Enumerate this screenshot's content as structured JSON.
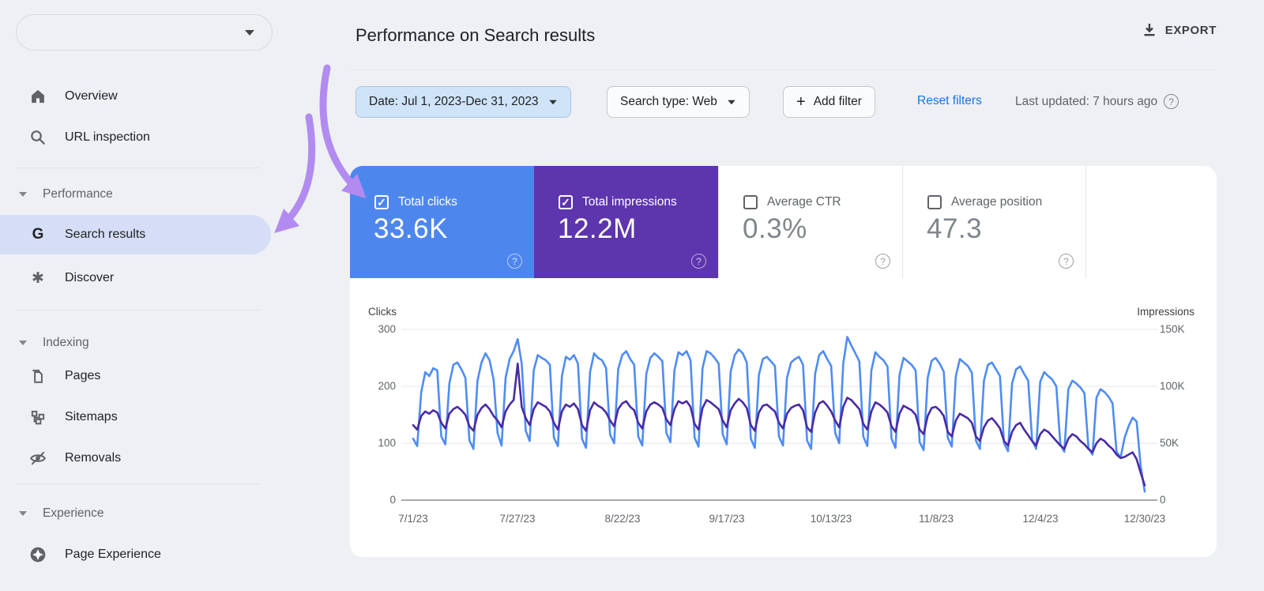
{
  "ui": {
    "check": "✓",
    "help": "?",
    "plus": "+"
  },
  "colors": {
    "accent_blue": "#4d87ee",
    "accent_purple": "#5d35ad",
    "line_blue": "#4e8cf5",
    "line_purple": "#4a2ba3",
    "arrow": "#b28bf0",
    "selected_pill": "#d5def6",
    "link_blue": "#1a73e8",
    "date_chip_bg": "#cfe4f9"
  },
  "sidebar": {
    "property_selector_value": "",
    "icon_glyphs": {
      "google_g": "G",
      "asterisk": "✱"
    },
    "items_top": [
      {
        "label": "Overview"
      },
      {
        "label": "URL inspection"
      }
    ],
    "sections": [
      {
        "header": "Performance",
        "items": [
          {
            "label": "Search results",
            "selected": true
          },
          {
            "label": "Discover",
            "selected": false
          }
        ]
      },
      {
        "header": "Indexing",
        "items": [
          {
            "label": "Pages"
          },
          {
            "label": "Sitemaps"
          },
          {
            "label": "Removals"
          }
        ]
      },
      {
        "header": "Experience",
        "items": [
          {
            "label": "Page Experience"
          }
        ]
      }
    ]
  },
  "header": {
    "title": "Performance on Search results",
    "export_label": "EXPORT"
  },
  "filters": {
    "date": "Date: Jul 1, 2023-Dec 31, 2023",
    "search_type": "Search type: Web",
    "add_filter": "Add filter",
    "reset": "Reset filters",
    "last_updated": "Last updated: 7 hours ago"
  },
  "metrics": [
    {
      "label": "Total clicks",
      "value": "33.6K",
      "checked": true,
      "bg": "#4d87ee"
    },
    {
      "label": "Total impressions",
      "value": "12.2M",
      "checked": true,
      "bg": "#5d35ad"
    },
    {
      "label": "Average CTR",
      "value": "0.3%",
      "checked": false,
      "bg": ""
    },
    {
      "label": "Average position",
      "value": "47.3",
      "checked": false,
      "bg": ""
    }
  ],
  "chart_data": {
    "type": "line",
    "title": "",
    "date_range": "7/1/23 - 12/30/23",
    "x_tick_labels": [
      "7/1/23",
      "7/27/23",
      "8/22/23",
      "9/17/23",
      "10/13/23",
      "11/8/23",
      "12/4/23",
      "12/30/23"
    ],
    "x_tick_days": [
      0,
      26,
      52,
      78,
      104,
      130,
      156,
      182
    ],
    "left_axis": {
      "label": "Clicks",
      "ticks": [
        300,
        200,
        100,
        0
      ],
      "range": [
        0,
        300
      ]
    },
    "right_axis": {
      "label": "Impressions",
      "ticks": [
        "150K",
        "100K",
        "50K",
        "0"
      ],
      "range_k": [
        0,
        150
      ]
    },
    "grid": true,
    "legend": "none",
    "series": [
      {
        "name": "Clicks",
        "axis": "left",
        "color": "#4e8cf5",
        "values": [
          108,
          95,
          190,
          225,
          218,
          232,
          228,
          112,
          98,
          205,
          238,
          242,
          230,
          215,
          105,
          90,
          210,
          242,
          258,
          246,
          212,
          118,
          96,
          215,
          248,
          262,
          283,
          240,
          122,
          104,
          228,
          255,
          250,
          246,
          238,
          110,
          95,
          218,
          252,
          247,
          255,
          240,
          108,
          92,
          225,
          258,
          250,
          246,
          232,
          115,
          100,
          230,
          255,
          262,
          248,
          238,
          112,
          96,
          222,
          250,
          258,
          252,
          244,
          118,
          102,
          228,
          260,
          255,
          262,
          246,
          110,
          94,
          232,
          262,
          258,
          250,
          240,
          116,
          98,
          226,
          255,
          265,
          258,
          242,
          108,
          92,
          220,
          248,
          252,
          244,
          236,
          112,
          96,
          215,
          242,
          248,
          252,
          238,
          105,
          90,
          222,
          255,
          262,
          248,
          236,
          118,
          100,
          240,
          287,
          272,
          258,
          244,
          112,
          95,
          228,
          260,
          252,
          246,
          235,
          108,
          92,
          220,
          250,
          244,
          238,
          228,
          102,
          88,
          215,
          245,
          250,
          240,
          226,
          110,
          94,
          218,
          248,
          242,
          236,
          224,
          105,
          90,
          210,
          238,
          242,
          230,
          218,
          100,
          86,
          205,
          230,
          235,
          222,
          210,
          105,
          90,
          208,
          225,
          218,
          212,
          200,
          98,
          85,
          195,
          210,
          205,
          198,
          188,
          92,
          80,
          180,
          195,
          190,
          182,
          170,
          85,
          75,
          110,
          130,
          145,
          138,
          60,
          15
        ]
      },
      {
        "name": "Impressions",
        "axis": "right",
        "unit": "K",
        "color": "#4a2ba3",
        "values_k": [
          66,
          62,
          74,
          78,
          76,
          79,
          77,
          68,
          63,
          76,
          80,
          82,
          79,
          75,
          65,
          61,
          75,
          81,
          84,
          80,
          74,
          70,
          64,
          78,
          84,
          88,
          120,
          82,
          72,
          66,
          80,
          86,
          84,
          82,
          78,
          68,
          62,
          78,
          84,
          82,
          85,
          80,
          66,
          61,
          79,
          86,
          83,
          81,
          77,
          70,
          65,
          80,
          85,
          87,
          82,
          79,
          68,
          63,
          78,
          84,
          86,
          84,
          81,
          71,
          66,
          80,
          87,
          85,
          87,
          82,
          67,
          62,
          81,
          88,
          86,
          83,
          80,
          70,
          64,
          79,
          85,
          89,
          86,
          81,
          66,
          61,
          77,
          83,
          84,
          81,
          78,
          68,
          63,
          76,
          81,
          83,
          84,
          79,
          64,
          60,
          77,
          85,
          87,
          83,
          78,
          70,
          64,
          82,
          90,
          88,
          84,
          80,
          67,
          62,
          78,
          86,
          84,
          81,
          77,
          65,
          60,
          76,
          83,
          81,
          79,
          75,
          62,
          58,
          74,
          81,
          82,
          79,
          74,
          60,
          56,
          70,
          76,
          74,
          72,
          68,
          56,
          52,
          64,
          70,
          72,
          68,
          63,
          52,
          48,
          60,
          66,
          68,
          62,
          57,
          52,
          48,
          58,
          62,
          60,
          56,
          52,
          48,
          45,
          54,
          58,
          56,
          52,
          49,
          45,
          42,
          50,
          54,
          52,
          48,
          45,
          40,
          37,
          38,
          40,
          42,
          36,
          24,
          13
        ]
      }
    ]
  }
}
